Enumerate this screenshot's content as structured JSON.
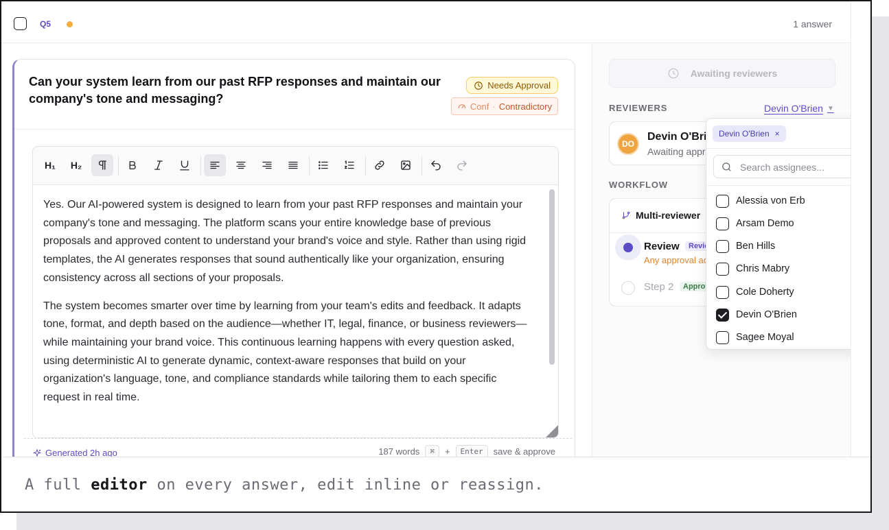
{
  "topbar": {
    "question_number": "Q5",
    "answer_count": "1 answer"
  },
  "card": {
    "question": "Can your system learn from our past RFP responses and maintain our company's tone and messaging?",
    "badge_approval": "Needs Approval",
    "badge_conf_label": "Conf",
    "badge_conf_sep": "·",
    "badge_conf_value": "Contradictory",
    "answer_paragraphs": [
      "Yes. Our AI-powered system is designed to learn from your past RFP responses and maintain your company's tone and messaging. The platform scans your entire knowledge base of previous proposals and approved content to understand your brand's voice and style. Rather than using rigid templates, the AI generates responses that sound authentically like your organization, ensuring consistency across all sections of your proposals.",
      "The system becomes smarter over time by learning from your team's edits and feedback. It adapts tone, format, and depth based on the audience—whether IT, legal, finance, or business reviewers—while maintaining your brand voice. This continuous learning happens with every question asked, using deterministic AI to generate dynamic, context-aware responses that build on your organization's language, tone, and compliance standards while tailoring them to each specific request in real time."
    ],
    "toolbar": {
      "h1": "H₁",
      "h2": "H₂"
    },
    "footer": {
      "generated": "Generated 2h ago",
      "word_count": "187 words",
      "kbd_cmd": "⌘",
      "plus": "+",
      "kbd_enter": "Enter",
      "save_label": "save & approve"
    }
  },
  "right_panel": {
    "awaiting_button": "Awaiting reviewers",
    "reviewers_label": "REVIEWERS",
    "reviewer_link": "Devin O'Brien",
    "reviewer": {
      "initials": "DO",
      "name": "Devin O'Brie",
      "status": "Awaiting appro"
    },
    "workflow_label": "WORKFLOW",
    "workflow": {
      "title": "Multi-reviewer",
      "step1_name": "Review",
      "step1_pill": "Revie",
      "step1_sub": "Any approval ad",
      "step2_name": "Step 2",
      "step2_pill": "Approv"
    }
  },
  "dropdown": {
    "chip": "Devin O'Brien",
    "chip_remove": "×",
    "search_placeholder": "Search assignees...",
    "options": [
      {
        "label": "Alessia von Erb",
        "checked": false
      },
      {
        "label": "Arsam Demo",
        "checked": false
      },
      {
        "label": "Ben Hills",
        "checked": false
      },
      {
        "label": "Chris Mabry",
        "checked": false
      },
      {
        "label": "Cole Doherty",
        "checked": false
      },
      {
        "label": "Devin O'Brien",
        "checked": true
      },
      {
        "label": "Sagee Moyal",
        "checked": false
      }
    ]
  },
  "caption": {
    "before": "A full ",
    "bold": "editor",
    "after": " on every answer, edit inline or reassign."
  },
  "colors": {
    "accent": "#5b4cc4",
    "status_dot": "#f2ad3d",
    "avatar": "#f0a440"
  }
}
